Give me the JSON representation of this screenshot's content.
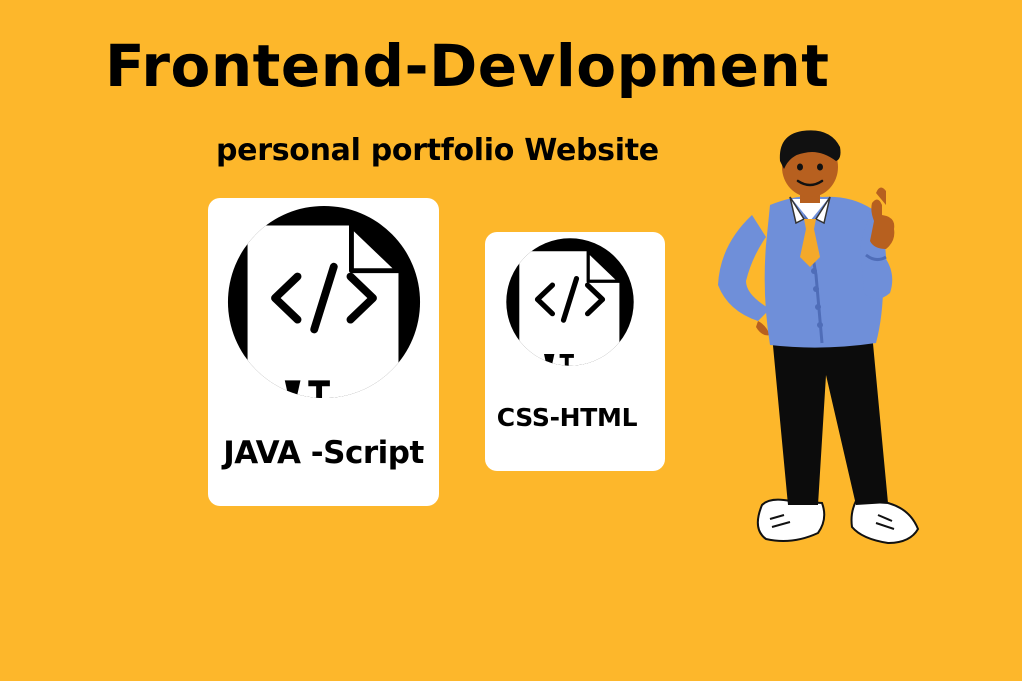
{
  "colors": {
    "background": "#FDB72B",
    "card": "#FFFFFF",
    "ink": "#000000",
    "cardigan": "#6F8FD9",
    "cardigan_shade": "#4F6DB8",
    "skin": "#B7601F",
    "pants": "#0C0C0C",
    "tie": "#F4A92A",
    "shoes": "#FFFFFF"
  },
  "header": {
    "title": "Frontend-Devlopment",
    "subtitle": "personal portfolio  Website"
  },
  "cards": [
    {
      "label": "JAVA -Script",
      "icon": "code-file-icon"
    },
    {
      "label": "CSS-HTML",
      "icon": "code-file-icon"
    }
  ],
  "illustration": {
    "icon": "thumbs-up-character-illustration"
  }
}
